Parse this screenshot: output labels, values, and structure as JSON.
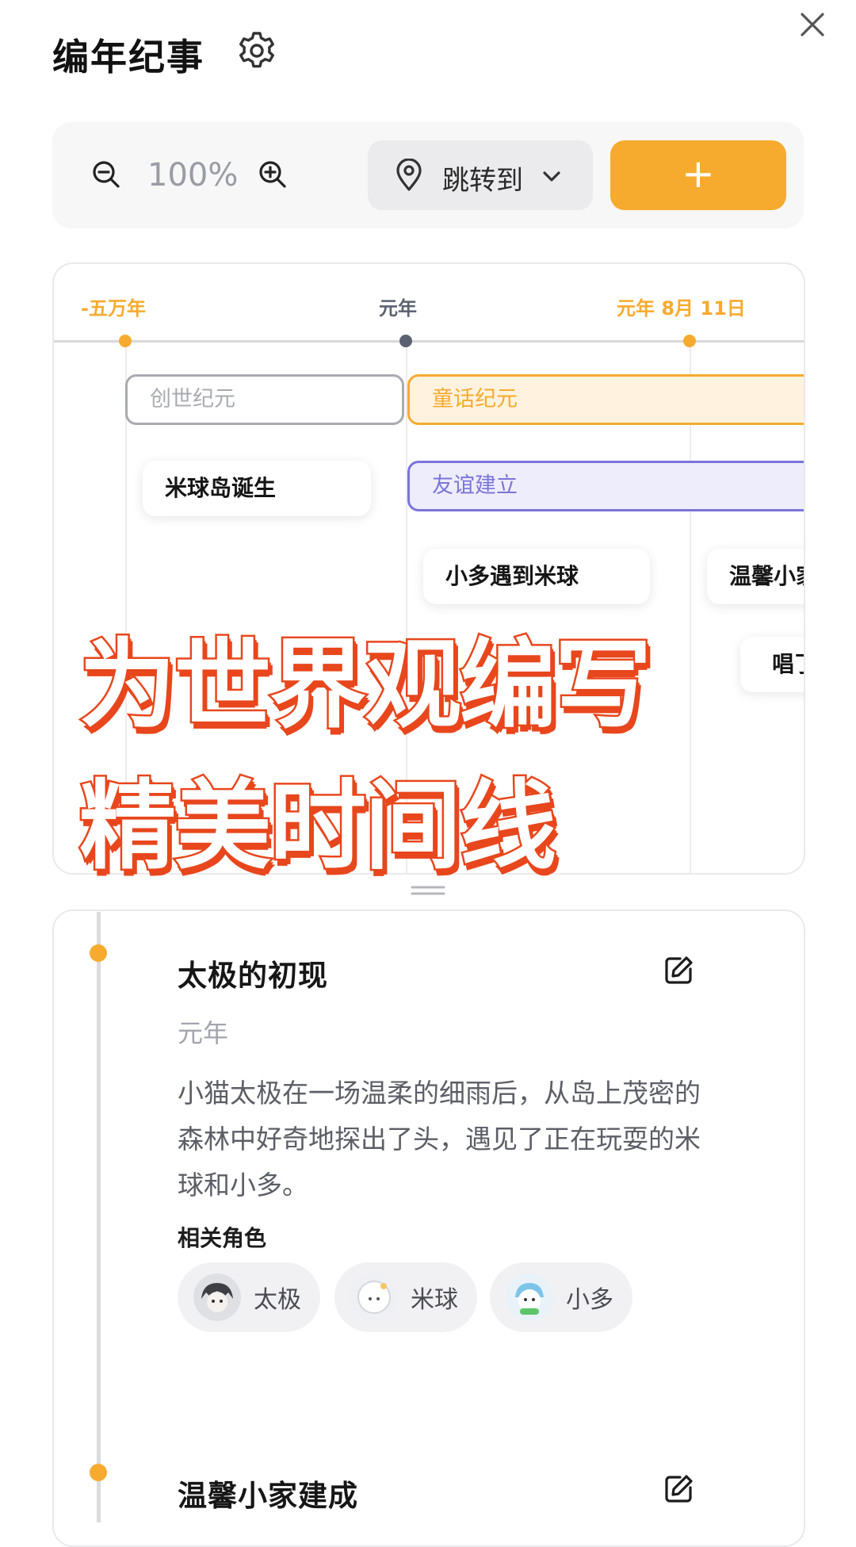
{
  "header": {
    "title": "编年纪事"
  },
  "toolbar": {
    "zoom_value": "100%",
    "jump_label": "跳转到",
    "add_label": "+"
  },
  "timeline": {
    "ticks": [
      {
        "label": "-五万年",
        "color": "#f6ab2e"
      },
      {
        "label": "元年",
        "color": "#5b6170"
      },
      {
        "label": "元年 8月 11日",
        "color": "#f6ab2e"
      }
    ],
    "eras": [
      {
        "label": "创世纪元",
        "color": "#a9abb1"
      },
      {
        "label": "童话纪元",
        "color": "#f6ab2e"
      },
      {
        "label": "友谊建立",
        "color": "#7a74d9"
      }
    ],
    "events": [
      {
        "label": "米球岛诞生"
      },
      {
        "label": "小多遇到米球"
      },
      {
        "label": "温馨小家"
      },
      {
        "label": "唱了"
      }
    ]
  },
  "overlay": {
    "line1": "为世界观编写",
    "line2": "精美时间线"
  },
  "detail": {
    "events": [
      {
        "title": "太极的初现",
        "date": "元年",
        "description": "小猫太极在一场温柔的细雨后，从岛上茂密的森林中好奇地探出了头，遇见了正在玩耍的米球和小多。",
        "roles_label": "相关角色",
        "roles": [
          {
            "name": "太极"
          },
          {
            "name": "米球"
          },
          {
            "name": "小多"
          }
        ]
      },
      {
        "title": "温馨小家建成"
      }
    ]
  },
  "colors": {
    "accent": "#f6ab2e",
    "overlay_stroke": "#e8461c"
  }
}
